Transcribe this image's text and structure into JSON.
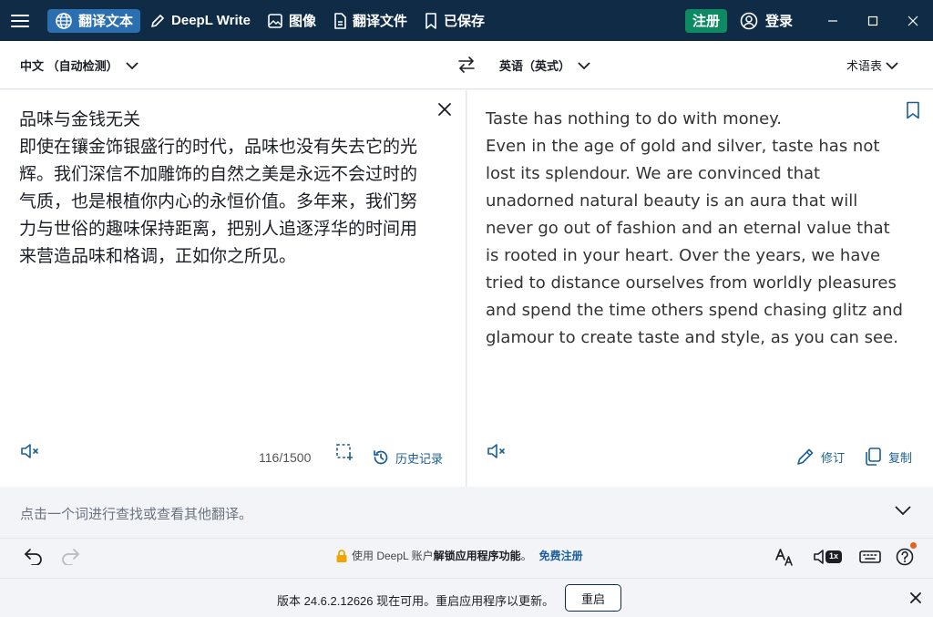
{
  "topbar": {
    "nav": [
      {
        "label": "翻译文本",
        "icon": "globe-icon"
      },
      {
        "label": "DeepL Write",
        "icon": "pen-icon"
      },
      {
        "label": "图像",
        "icon": "image-icon"
      },
      {
        "label": "翻译文件",
        "icon": "document-icon"
      },
      {
        "label": "已保存",
        "icon": "bookmark-icon"
      }
    ],
    "signup_label": "注册",
    "login_label": "登录"
  },
  "langbar": {
    "source_lang": "中文 （自动检测）",
    "target_lang": "英语（英式）",
    "glossary_label": "术语表"
  },
  "source": {
    "text": "品味与金钱无关\n即使在镶金饰银盛行的时代，品味也没有失去它的光辉。我们深信不加雕饰的自然之美是永远不会过时的气质，也是根植你内心的永恒价值。多年来，我们努力与世俗的趣味保持距离，把别人追逐浮华的时间用来营造品味和格调，正如你之所见。",
    "char_count": "116/1500",
    "history_label": "历史记录"
  },
  "target": {
    "text": "Taste has nothing to do with money.\nEven in the age of gold and silver, taste has not lost its splendour. We are convinced that unadorned natural beauty is an aura that will never go out of fashion and an eternal value that is rooted in your heart. Over the years, we have tried to distance ourselves from worldly pleasures and spend the time others spend chasing glitz and glamour to create taste and style, as you can see.",
    "edit_label": "修订",
    "copy_label": "复制"
  },
  "dictionary": {
    "hint": "点击一个词进行查找或查看其他翻译。"
  },
  "footer": {
    "promo_prefix": "使用 DeepL 账户",
    "promo_strong": "解锁应用程序功能",
    "promo_suffix": "。",
    "promo_link": "免费注册",
    "speed_badge": "1x"
  },
  "update": {
    "message": "版本 24.6.2.12626 现在可用。重启应用程序以更新。",
    "restart_label": "重启"
  },
  "colors": {
    "topbar_bg": "#0f2b46",
    "active_tab": "#2c6fb0",
    "signup_bg": "#0e8a63",
    "link": "#1a5e9a",
    "notif_dot": "#e8611a"
  }
}
